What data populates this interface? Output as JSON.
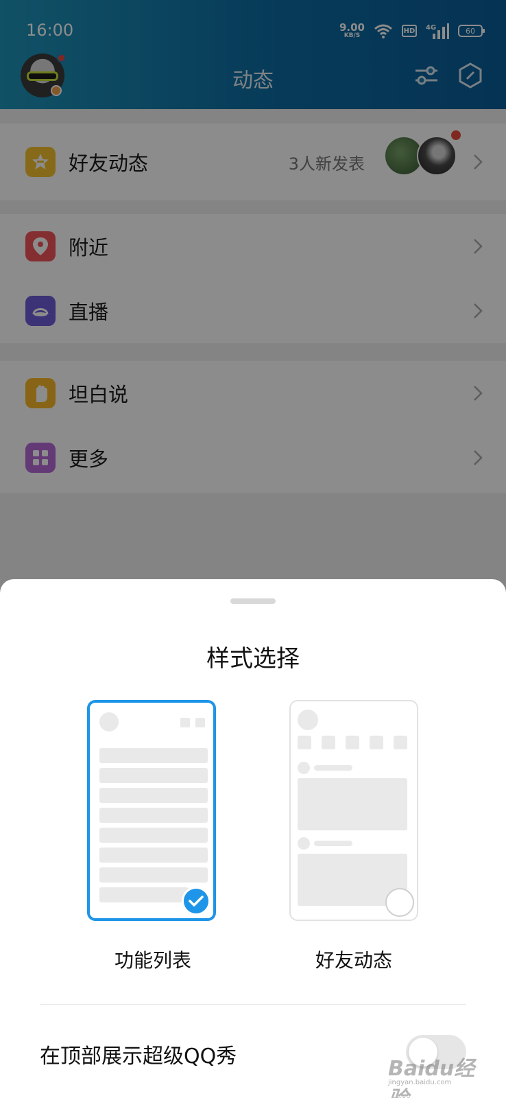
{
  "status_bar": {
    "time": "16:00",
    "speed_value": "9.00",
    "speed_unit": "KB/S",
    "hd_label": "HD",
    "network": "4G",
    "battery": "60"
  },
  "header": {
    "title": "动态"
  },
  "list": {
    "groups": [
      [
        {
          "label": "好友动态",
          "sub": "3人新发表",
          "icon": "star-badge-icon",
          "color": "#f5c12e"
        }
      ],
      [
        {
          "label": "附近",
          "icon": "location-pin-icon",
          "color": "#f2545b"
        },
        {
          "label": "直播",
          "icon": "live-icon",
          "color": "#6e5bd8"
        }
      ],
      [
        {
          "label": "坦白说",
          "icon": "hand-icon",
          "color": "#f7b928"
        },
        {
          "label": "更多",
          "icon": "grid-icon",
          "color": "#b66ad8"
        }
      ]
    ]
  },
  "sheet": {
    "title": "样式选择",
    "options": [
      {
        "label": "功能列表",
        "selected": true
      },
      {
        "label": "好友动态",
        "selected": false
      }
    ],
    "toggle_label": "在顶部展示超级QQ秀",
    "toggle_on": false
  },
  "watermark": {
    "text": "Baidu经验",
    "sub": "jingyan.baidu.com"
  },
  "colors": {
    "accent": "#1e95e8",
    "header_start": "#1f94b9",
    "header_end": "#0a5d98"
  }
}
